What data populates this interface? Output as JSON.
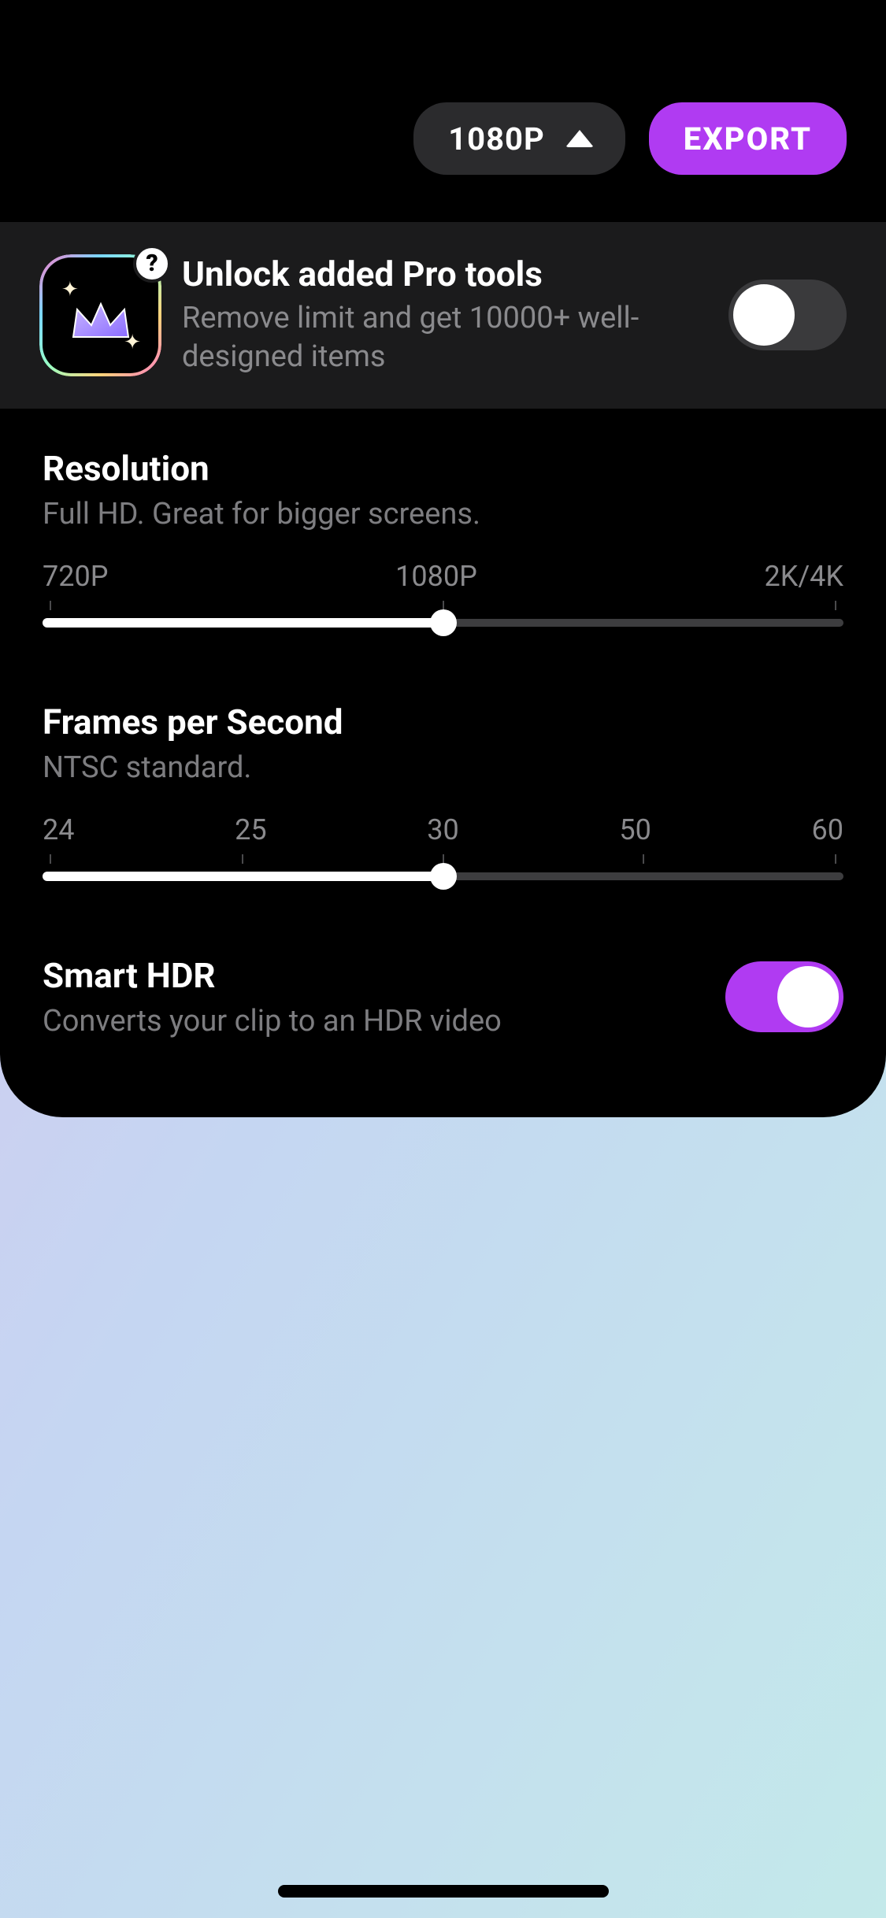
{
  "header": {
    "resolution_label": "1080P",
    "export_label": "EXPORT"
  },
  "pro_banner": {
    "title": "Unlock added Pro tools",
    "subtitle": "Remove limit and get 10000+ well-designed items",
    "toggle_on": false,
    "help_badge": "?"
  },
  "resolution": {
    "title": "Resolution",
    "subtitle": "Full HD. Great for bigger screens.",
    "options": [
      "720P",
      "1080P",
      "2K/4K"
    ],
    "selected_index": 1,
    "fill_percent": 50,
    "tick_positions_percent": [
      1,
      50,
      99
    ]
  },
  "fps": {
    "title": "Frames per Second",
    "subtitle": "NTSC standard.",
    "options": [
      "24",
      "25",
      "30",
      "50",
      "60"
    ],
    "selected_index": 2,
    "fill_percent": 50,
    "tick_positions_percent": [
      1,
      25,
      50,
      75,
      99
    ]
  },
  "hdr": {
    "title": "Smart HDR",
    "subtitle": "Converts your clip to an HDR video",
    "toggle_on": true
  },
  "colors": {
    "accent": "#b03bf2"
  }
}
